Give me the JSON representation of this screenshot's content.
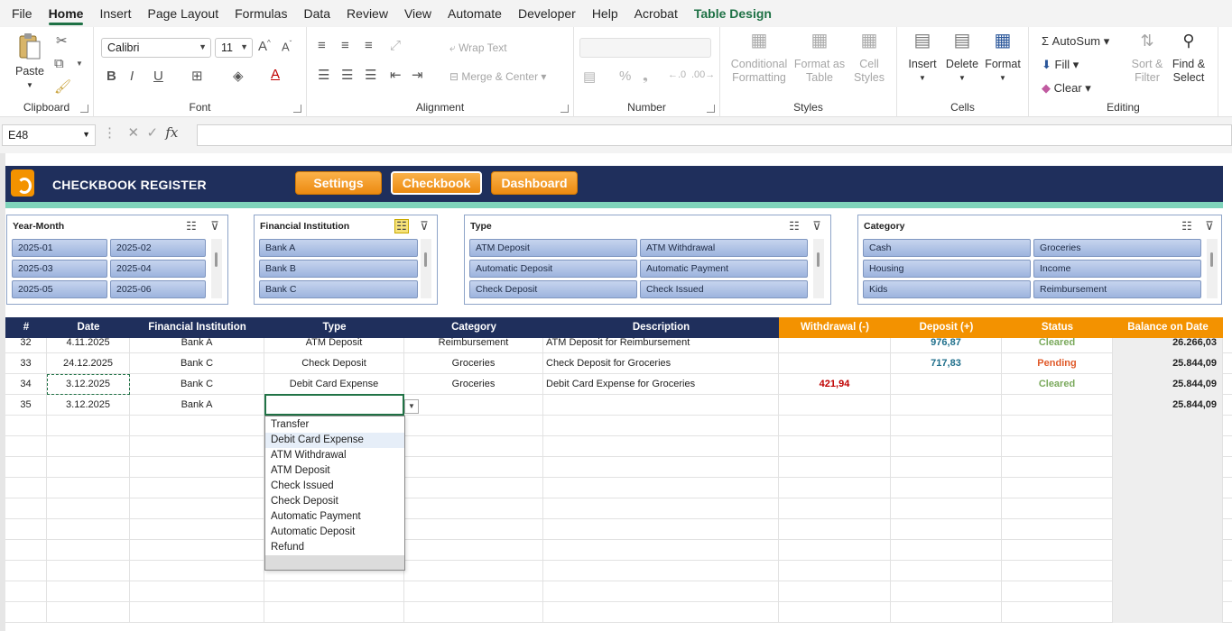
{
  "menu": [
    "File",
    "Home",
    "Insert",
    "Page Layout",
    "Formulas",
    "Data",
    "Review",
    "View",
    "Automate",
    "Developer",
    "Help",
    "Acrobat",
    "Table Design"
  ],
  "ribbon": {
    "clipboard": {
      "label": "Clipboard",
      "paste": "Paste"
    },
    "font": {
      "label": "Font",
      "name": "Calibri",
      "size": "11",
      "bold": "B",
      "italic": "I",
      "underline": "U"
    },
    "alignment": {
      "label": "Alignment",
      "wrap": "Wrap Text",
      "merge": "Merge & Center"
    },
    "number": {
      "label": "Number",
      "format": ""
    },
    "styles": {
      "label": "Styles",
      "conditional": "Conditional",
      "conditional2": "Formatting",
      "format_table": "Format as",
      "format_table2": "Table",
      "cell_styles": "Cell",
      "cell_styles2": "Styles"
    },
    "cells": {
      "label": "Cells",
      "insert": "Insert",
      "delete": "Delete",
      "format": "Format"
    },
    "editing": {
      "label": "Editing",
      "autosum": "AutoSum",
      "fill": "Fill",
      "clear": "Clear",
      "sort": "Sort &",
      "sort2": "Filter",
      "find": "Find &",
      "find2": "Select"
    }
  },
  "formula_bar": {
    "name_box": "E48",
    "value": ""
  },
  "banner": {
    "title": "CHECKBOOK REGISTER",
    "buttons": [
      "Settings",
      "Checkbook",
      "Dashboard"
    ]
  },
  "slicers": {
    "year_month": {
      "title": "Year-Month",
      "items": [
        "2025-01",
        "2025-02",
        "2025-03",
        "2025-04",
        "2025-05",
        "2025-06"
      ]
    },
    "institution": {
      "title": "Financial Institution",
      "items": [
        "Bank A",
        "Bank B",
        "Bank C"
      ]
    },
    "type": {
      "title": "Type",
      "items": [
        "ATM Deposit",
        "ATM Withdrawal",
        "Automatic Deposit",
        "Automatic Payment",
        "Check Deposit",
        "Check Issued"
      ]
    },
    "category": {
      "title": "Category",
      "items": [
        "Cash",
        "Groceries",
        "Housing",
        "Income",
        "Kids",
        "Reimbursement"
      ]
    }
  },
  "table": {
    "headers": [
      "#",
      "Date",
      "Financial Institution",
      "Type",
      "Category",
      "Description",
      "Withdrawal (-)",
      "Deposit (+)",
      "Status",
      "Balance on Date"
    ],
    "rows": [
      {
        "num": "32",
        "date": "4.11.2025",
        "inst": "Bank A",
        "type": "ATM Deposit",
        "cat": "Reimbursement",
        "desc": "ATM Deposit for Reimbursement",
        "wd": "",
        "dep": "976,87",
        "status": "Cleared",
        "bal": "26.266,03"
      },
      {
        "num": "33",
        "date": "24.12.2025",
        "inst": "Bank C",
        "type": "Check Deposit",
        "cat": "Groceries",
        "desc": "Check Deposit for Groceries",
        "wd": "",
        "dep": "717,83",
        "status": "Pending",
        "bal": "25.844,09"
      },
      {
        "num": "34",
        "date": "3.12.2025",
        "inst": "Bank C",
        "type": "Debit Card Expense",
        "cat": "Groceries",
        "desc": "Debit Card Expense for Groceries",
        "wd": "421,94",
        "dep": "",
        "status": "Cleared",
        "bal": "25.844,09"
      },
      {
        "num": "35",
        "date": "3.12.2025",
        "inst": "Bank A",
        "type": "",
        "cat": "",
        "desc": "",
        "wd": "",
        "dep": "",
        "status": "",
        "bal": "25.844,09"
      }
    ]
  },
  "dropdown": {
    "items": [
      "Transfer",
      "Debit Card Expense",
      "ATM Withdrawal",
      "ATM Deposit",
      "Check Issued",
      "Check Deposit",
      "Automatic Payment",
      "Automatic Deposit",
      "Refund"
    ],
    "hover_index": 1
  },
  "colors": {
    "navy": "#1f2f5c",
    "orange": "#f39200",
    "teal_stripe": "#7fd4bb",
    "excel_green": "#217346"
  }
}
